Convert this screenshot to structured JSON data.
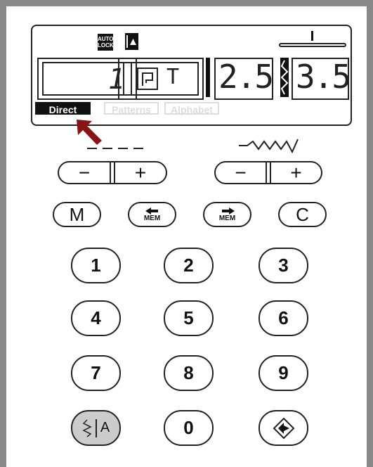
{
  "lcd": {
    "auto_lock_line1": "AUTO",
    "auto_lock_line2": "LOCK",
    "pattern_number": "1",
    "letters": "T",
    "length_value": "2.5",
    "width_value": "3.5",
    "modes": [
      "Direct",
      "Patterns",
      "Alphabet"
    ]
  },
  "keys": {
    "minus": "−",
    "plus": "+",
    "m": "M",
    "mem": "MEM",
    "c": "C",
    "n1": "1",
    "n2": "2",
    "n3": "3",
    "n4": "4",
    "n5": "5",
    "n6": "6",
    "n7": "7",
    "n8": "8",
    "n9": "9",
    "n0": "0",
    "mode_a": "A"
  }
}
